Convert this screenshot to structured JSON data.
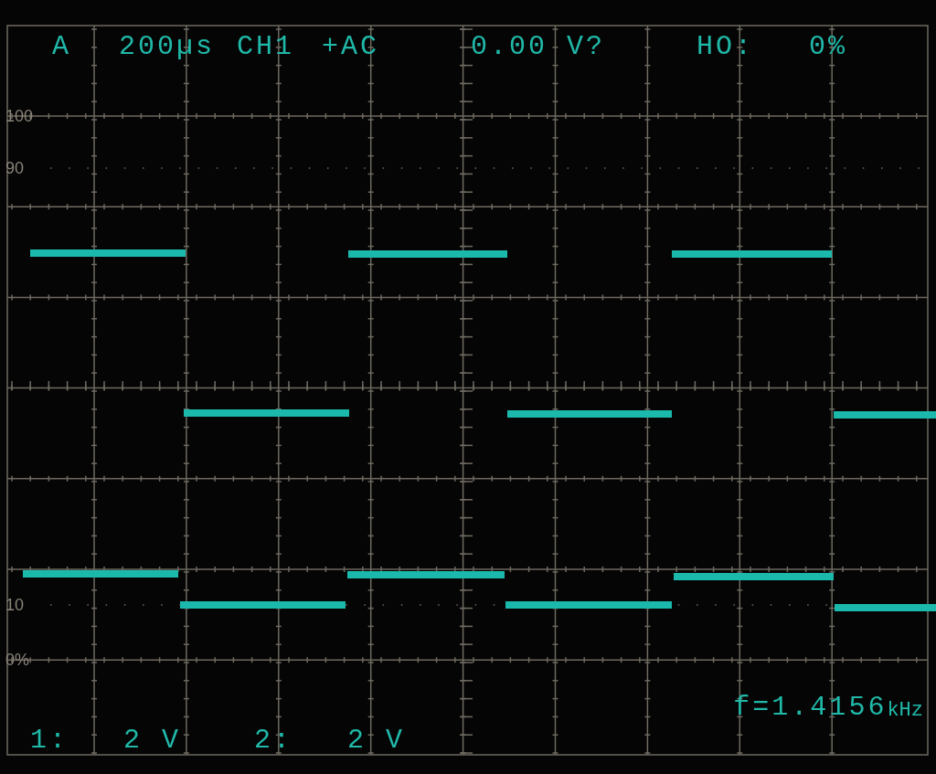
{
  "header": {
    "mode": "A",
    "timebase": "200µs",
    "channel": "CH1",
    "coupling": "+AC",
    "trigger_level": "0.00 V?",
    "holdoff_label": "HO:",
    "holdoff_value": "0%"
  },
  "scale_labels": [
    "100",
    "90",
    "10",
    "0%"
  ],
  "frequency": {
    "value": "f=1.4156",
    "unit": "kHz"
  },
  "channels": [
    {
      "label": "1:",
      "scale": "2 V"
    },
    {
      "label": "2:",
      "scale": "2 V"
    }
  ]
}
